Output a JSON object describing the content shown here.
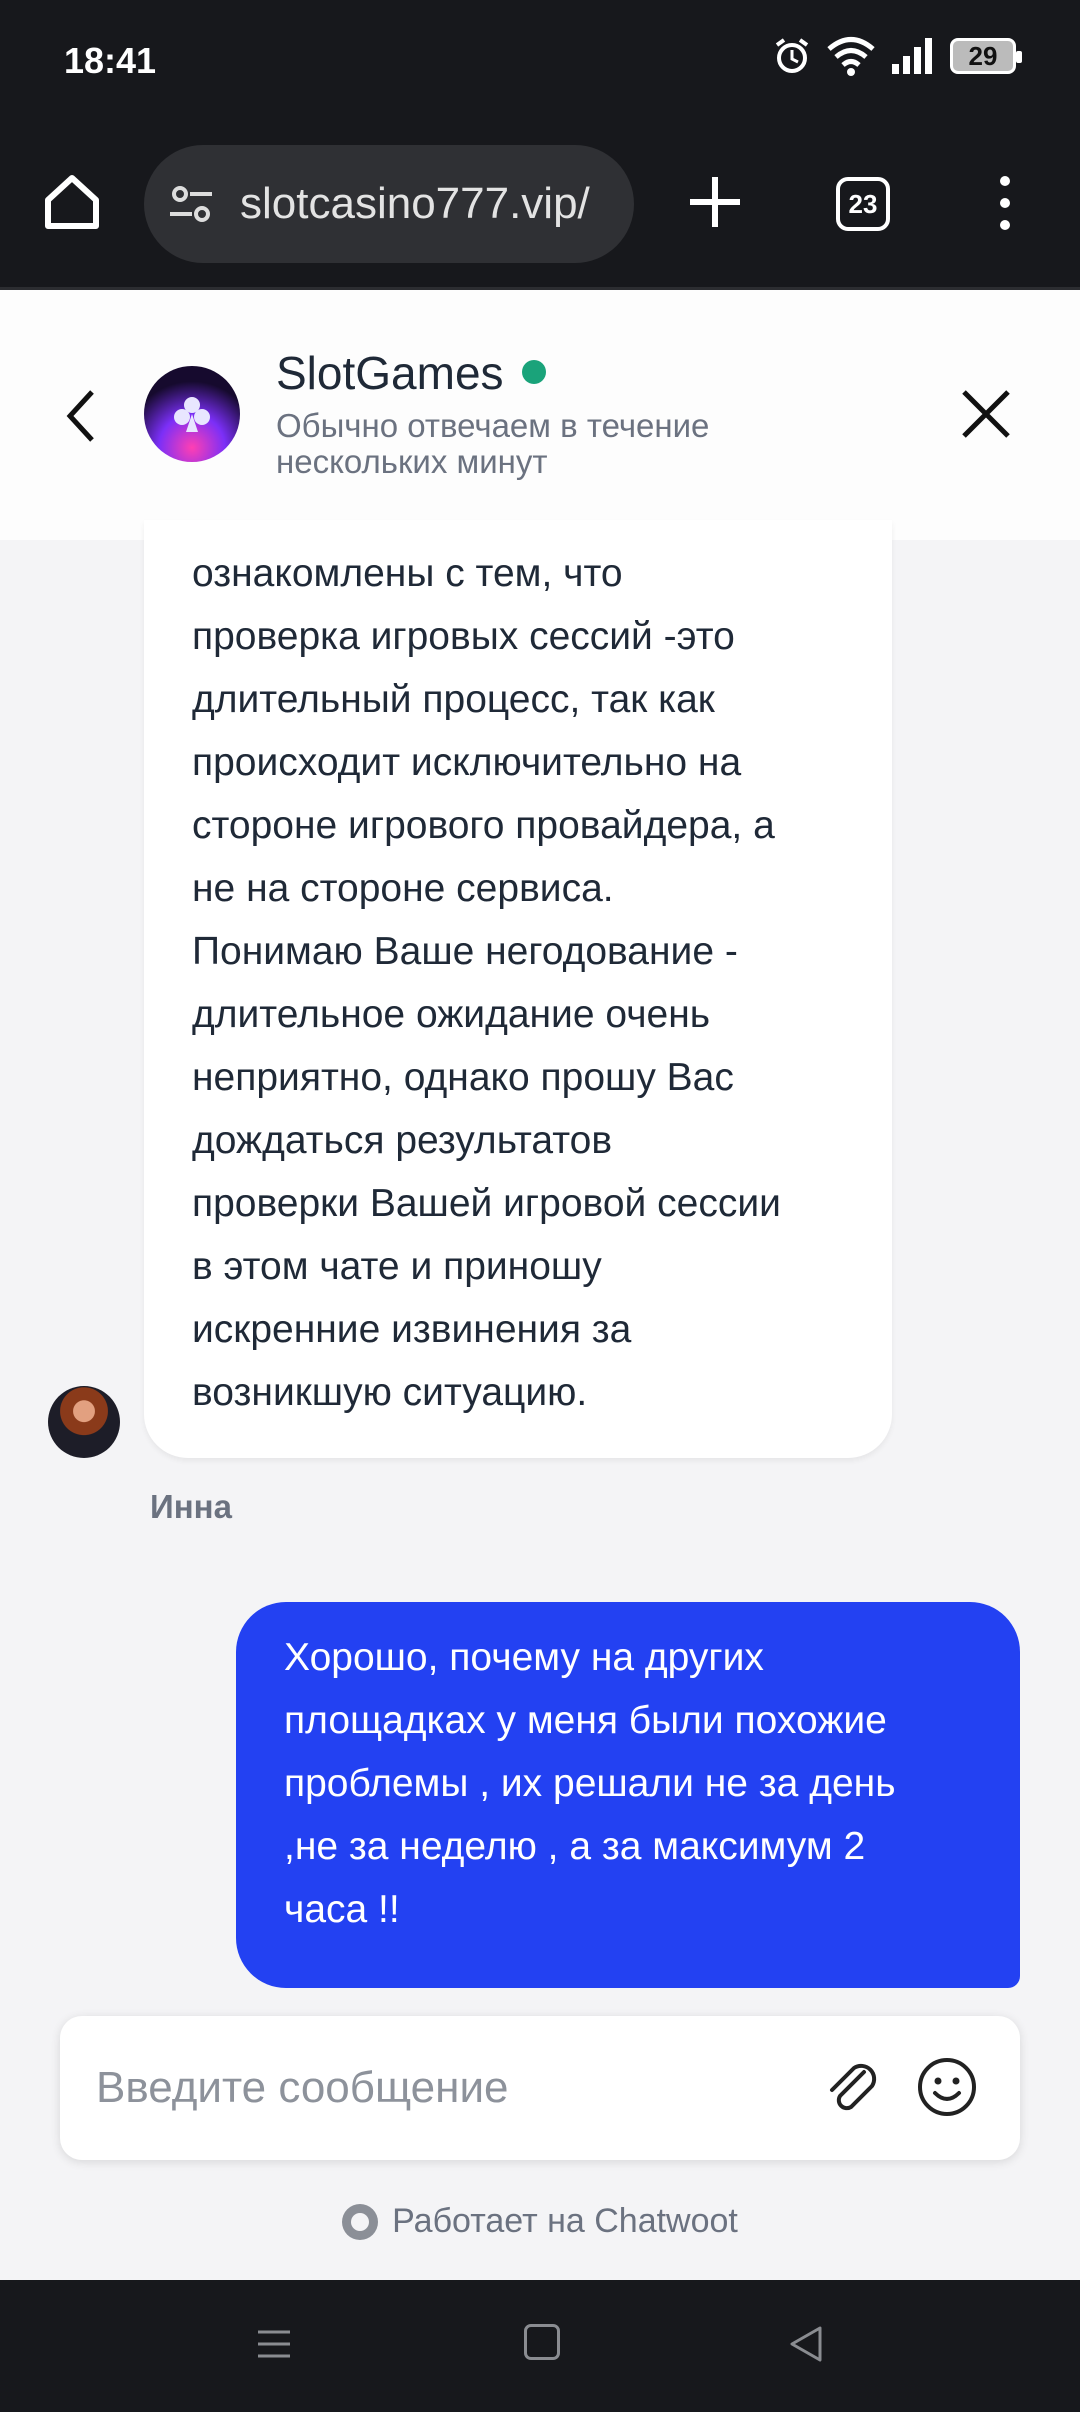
{
  "status_bar": {
    "time": "18:41",
    "battery": "29"
  },
  "browser": {
    "url": "slotcasino777.vip/",
    "tab_count": "23"
  },
  "chat_header": {
    "title": "SlotGames",
    "subtitle": "Обычно отвечаем в течение нескольких минут",
    "online": true
  },
  "messages": {
    "incoming": {
      "lines": [
        "ознакомлены с тем, что",
        "проверка игровых сессий -это",
        "длительный процесс, так как",
        "происходит исключительно на",
        "стороне игрового провайдера, а",
        "не на стороне сервиса.",
        "Понимаю Ваше негодование -",
        "длительное ожидание очень",
        "неприятно, однако прошу Вас",
        "дождаться результатов",
        "проверки Вашей игровой сессии",
        "в этом чате и приношу",
        "искренние извинения за",
        "возникшую ситуацию."
      ],
      "sender": "Инна"
    },
    "outgoing": {
      "lines": [
        "Хорошо, почему на других",
        "площадках у меня были похожие",
        "проблемы , их решали не за день",
        ",не за неделю , а за максимум 2",
        "часа !!"
      ]
    }
  },
  "composer": {
    "placeholder": "Введите сообщение"
  },
  "footer": {
    "powered_by": "Работает на Chatwoot"
  },
  "colors": {
    "outgoing_bubble": "#2341f2",
    "online": "#1aa37a"
  }
}
